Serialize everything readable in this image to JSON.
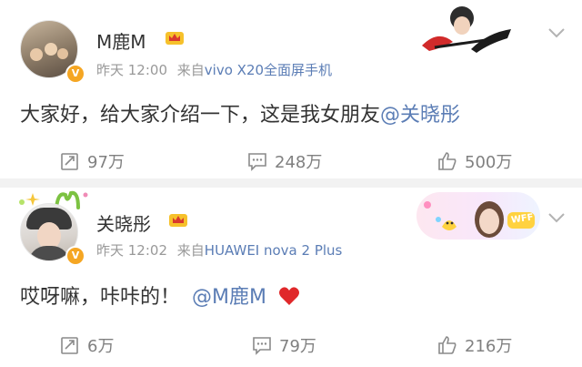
{
  "post1": {
    "username": "M鹿M",
    "time": "昨天 12:00",
    "source_prefix": "来自",
    "device": "vivo X20全面屏手机",
    "content_text": "大家好，给大家介绍一下，这是我女朋友",
    "content_mention": "@关晓彤",
    "repost_count": "97万",
    "comment_count": "248万",
    "like_count": "500万"
  },
  "post2": {
    "username": "关晓彤",
    "time": "昨天 12:02",
    "source_prefix": "来自",
    "device": "HUAWEI nova 2 Plus",
    "content_text": "哎呀嘛，咔咔的！",
    "content_mention": "@M鹿M",
    "repost_count": "6万",
    "comment_count": "79万",
    "like_count": "216万",
    "card_label": "WFF"
  },
  "colors": {
    "link": "#5b7db5",
    "meta": "#999999",
    "badge": "#f5a623",
    "heart": "#e0282a"
  },
  "icons": {
    "repost": "repost-icon",
    "comment": "comment-icon",
    "like": "thumbs-up-icon",
    "more": "chevron-down-icon"
  }
}
